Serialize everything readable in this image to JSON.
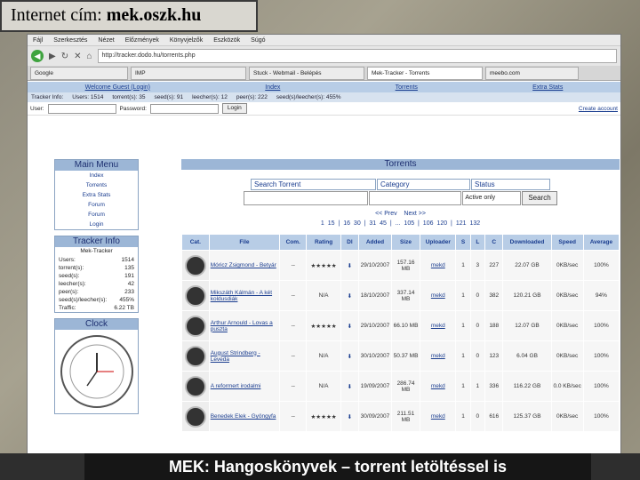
{
  "slide": {
    "title_prefix": "Internet cím: ",
    "title_domain": "mek.oszk.hu",
    "caption": "MEK: Hangoskönyvek – torrent letöltéssel is"
  },
  "browser": {
    "menu": [
      "Fájl",
      "Szerkesztés",
      "Nézet",
      "Előzmények",
      "Könyvjelzők",
      "Eszközök",
      "Súgó"
    ],
    "url": "http://tracker.dodo.hu/torrents.php",
    "tabs": [
      {
        "label": "Google"
      },
      {
        "label": "IMP"
      },
      {
        "label": "Stuck - Webmail - Belépés"
      },
      {
        "label": "Mek-Tracker - Torrents"
      },
      {
        "label": "meebo.com"
      }
    ]
  },
  "site": {
    "nav": [
      "Welcome Guest (Login)",
      "Index",
      "Torrents",
      "Extra Stats"
    ],
    "stats": [
      {
        "label": "Tracker Info:",
        "value": ""
      },
      {
        "label": "Users:",
        "value": "1514"
      },
      {
        "label": "torrent(s):",
        "value": "35"
      },
      {
        "label": "seed(s):",
        "value": "91"
      },
      {
        "label": "leecher(s):",
        "value": "12"
      },
      {
        "label": "peer(s):",
        "value": "222"
      },
      {
        "label": "seed(s)/leecher(s):",
        "value": "455%"
      }
    ],
    "login": {
      "user_label": "User:",
      "password_label": "Password:",
      "button": "Login",
      "create": "Create account"
    }
  },
  "sidebar": {
    "menu_title": "Main Menu",
    "menu_items": [
      "Index",
      "Torrents",
      "Extra Stats",
      "Forum",
      "Forum",
      "Login"
    ],
    "info_title": "Tracker Info",
    "info_subtitle": "Mek-Tracker",
    "info_rows": [
      {
        "k": "Users:",
        "v": "1514"
      },
      {
        "k": "torrent(s):",
        "v": "135"
      },
      {
        "k": "seed(s):",
        "v": "191"
      },
      {
        "k": "leecher(s):",
        "v": "42"
      },
      {
        "k": "peer(s):",
        "v": "233"
      },
      {
        "k": "seed(s)/leecher(s):",
        "v": "455%"
      },
      {
        "k": "Traffic:",
        "v": "6.22 TB"
      }
    ],
    "clock_title": "Clock"
  },
  "torrents": {
    "title": "Torrents",
    "search_label": "Search Torrent",
    "category_label": "Category",
    "status_label": "Status",
    "status_value": "Active only",
    "search_button": "Search",
    "pager_prev": "<< Prev",
    "pager_next": "Next >>",
    "pages": "1 15 | 16 30 | 31 45 | ... 105 | 106 120 | 121 132",
    "columns": [
      "Cat.",
      "File",
      "Com.",
      "Rating",
      "Dl",
      "Added",
      "Size",
      "Uploader",
      "S",
      "L",
      "C",
      "Downloaded",
      "Speed",
      "Average"
    ],
    "rows": [
      {
        "file": "Móricz Zsigmond - Betyár",
        "com": "--",
        "rating": "★★★★★",
        "added": "29/10/2007",
        "size": "157.16 MB",
        "uploader": "mekd",
        "s": "1",
        "l": "3",
        "c": "227",
        "downloaded": "22.07 GB",
        "speed": "0KB/sec",
        "average": "100%"
      },
      {
        "file": "Mikszáth Kálmán - A két koldusdiák",
        "com": "--",
        "rating": "N/A",
        "added": "18/10/2007",
        "size": "337.14 MB",
        "uploader": "mekd",
        "s": "1",
        "l": "0",
        "c": "382",
        "downloaded": "120.21 GB",
        "speed": "0KB/sec",
        "average": "94%"
      },
      {
        "file": "Arthur Arnould - Lovas a puszta",
        "com": "--",
        "rating": "★★★★★",
        "added": "29/10/2007",
        "size": "66.10 MB",
        "uploader": "mekd",
        "s": "1",
        "l": "0",
        "c": "188",
        "downloaded": "12.07 GB",
        "speed": "0KB/sec",
        "average": "100%"
      },
      {
        "file": "August Strindberg - Leveda",
        "com": "--",
        "rating": "N/A",
        "added": "30/10/2007",
        "size": "50.37 MB",
        "uploader": "mekd",
        "s": "1",
        "l": "0",
        "c": "123",
        "downloaded": "6.04 GB",
        "speed": "0KB/sec",
        "average": "100%"
      },
      {
        "file": "A reformert irodalmi",
        "com": "--",
        "rating": "N/A",
        "added": "19/09/2007",
        "size": "286.74 MB",
        "uploader": "mekd",
        "s": "1",
        "l": "1",
        "c": "336",
        "downloaded": "116.22 GB",
        "speed": "0.0 KB/sec",
        "average": "100%"
      },
      {
        "file": "Benedek Elek - Gyöngyfa",
        "com": "--",
        "rating": "★★★★★",
        "added": "30/09/2007",
        "size": "211.51 MB",
        "uploader": "mekd",
        "s": "1",
        "l": "0",
        "c": "616",
        "downloaded": "125.37 GB",
        "speed": "0KB/sec",
        "average": "100%"
      }
    ]
  }
}
